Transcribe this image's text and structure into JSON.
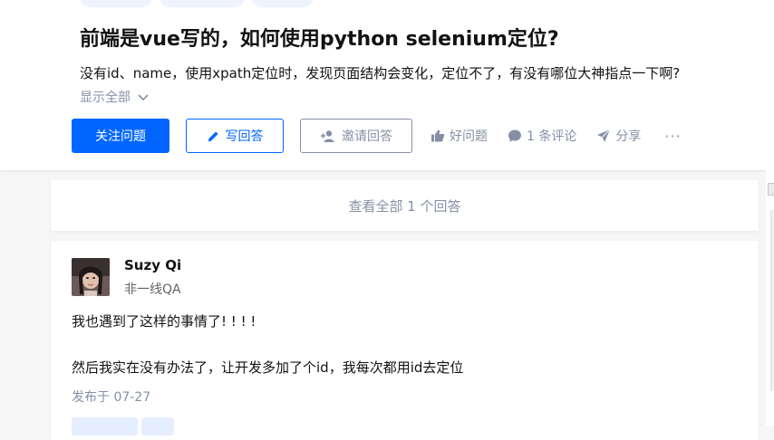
{
  "question": {
    "title": "前端是vue写的，如何使用python selenium定位?",
    "detail": "没有id、name，使用xpath定位时，发现页面结构会变化，定位不了，有没有哪位大神指点一下啊?",
    "show_all_label": "显示全部"
  },
  "actions": {
    "follow_label": "关注问题",
    "write_answer_label": "写回答",
    "invite_label": "邀请回答",
    "good_question_label": "好问题",
    "comments_label": "1 条评论",
    "share_label": "分享",
    "more_label": "···"
  },
  "view_all_answers_label": "查看全部 1 个回答",
  "answer": {
    "author_name": "Suzy Qi",
    "author_headline": "非一线QA",
    "paragraphs": [
      "我也遇到了这样的事情了! ! ! !",
      "然后我实在没有办法了，让开发多加了个id，我每次都用id去定位"
    ],
    "published": "发布于 07-27"
  },
  "colors": {
    "brand_blue": "#0066ff",
    "muted_gray": "#8590a6",
    "text": "#121212",
    "page_bg": "#f6f6f6"
  },
  "icons": [
    "chevron-down-icon",
    "pencil-icon",
    "add-person-icon",
    "thumbs-up-icon",
    "comment-bubble-icon",
    "paper-plane-icon"
  ]
}
